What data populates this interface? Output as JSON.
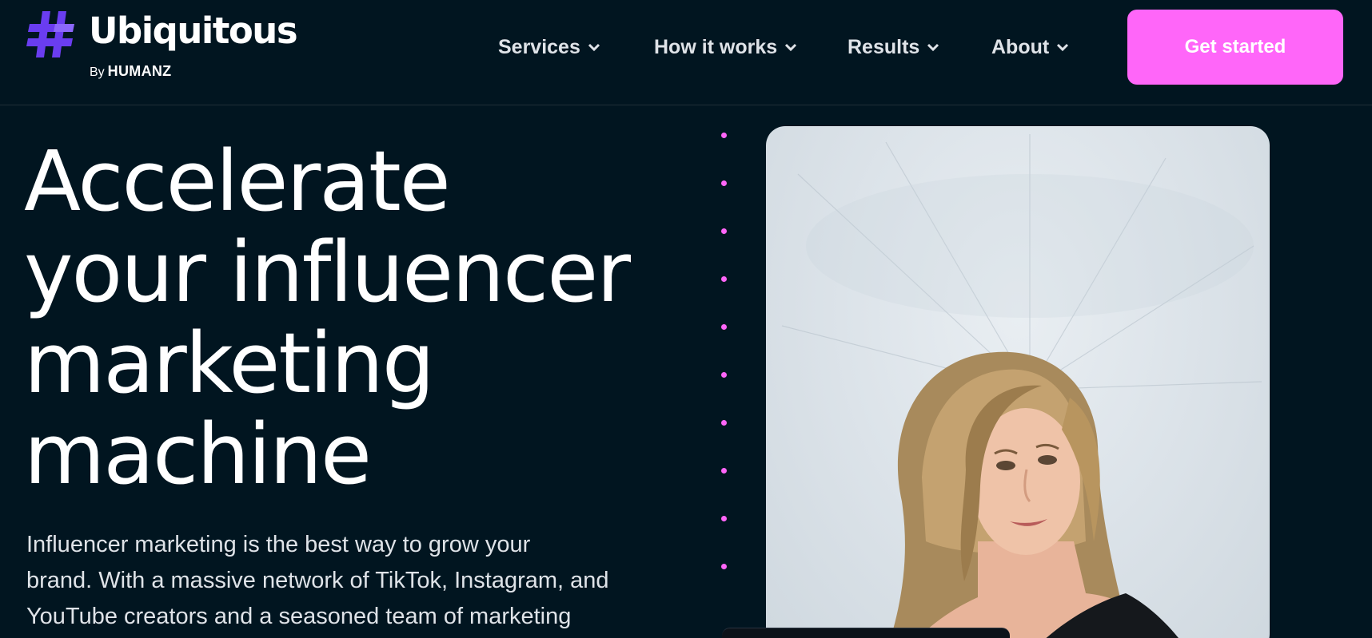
{
  "brand": {
    "logo_mark": "hash-logo-icon",
    "name": "Ubiquitous",
    "by_prefix": "By",
    "by_brand": "HUMANZ"
  },
  "nav": {
    "items": [
      {
        "label": "Services",
        "icon": "chevron-down-icon"
      },
      {
        "label": "How it works",
        "icon": "chevron-down-icon"
      },
      {
        "label": "Results",
        "icon": "chevron-down-icon"
      },
      {
        "label": "About",
        "icon": "chevron-down-icon"
      }
    ],
    "cta_label": "Get started"
  },
  "hero": {
    "title_lines": [
      "Accelerate",
      "your influencer",
      "marketing",
      "machine"
    ],
    "body_lines": [
      "Influencer marketing is the best way to grow your",
      "brand. With a massive network of TikTok, Instagram, and",
      "YouTube creators and a seasoned team of marketing"
    ]
  },
  "colors": {
    "background": "#011520",
    "accent_pink": "#ff66f9",
    "logo_purple": "#6a3df0",
    "nav_text": "#dfe3e8"
  }
}
